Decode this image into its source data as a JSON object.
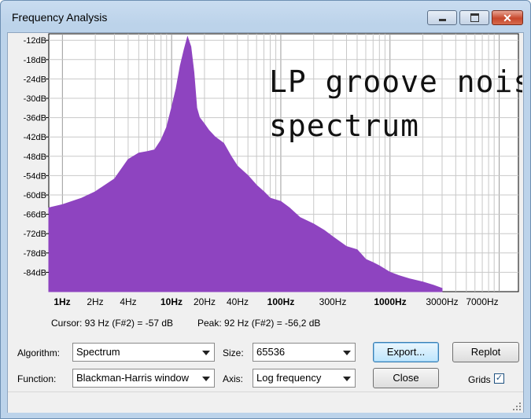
{
  "window": {
    "title": "Frequency Analysis"
  },
  "chart_data": {
    "type": "area",
    "annotation": "LP groove noise\nspectrum",
    "x_scale": "log",
    "xlim": [
      0.75,
      15000
    ],
    "ylim": [
      -90,
      -10
    ],
    "grid": true,
    "y_ticks": [
      "-12dB",
      "-18dB",
      "-24dB",
      "-30dB",
      "-36dB",
      "-42dB",
      "-48dB",
      "-54dB",
      "-60dB",
      "-66dB",
      "-72dB",
      "-78dB",
      "-84dB"
    ],
    "x_ticks": [
      {
        "label": "1Hz",
        "value": 1,
        "bold": true
      },
      {
        "label": "2Hz",
        "value": 2,
        "bold": false
      },
      {
        "label": "4Hz",
        "value": 4,
        "bold": false
      },
      {
        "label": "10Hz",
        "value": 10,
        "bold": true
      },
      {
        "label": "20Hz",
        "value": 20,
        "bold": false
      },
      {
        "label": "40Hz",
        "value": 40,
        "bold": false
      },
      {
        "label": "100Hz",
        "value": 100,
        "bold": true
      },
      {
        "label": "300Hz",
        "value": 300,
        "bold": false
      },
      {
        "label": "1000Hz",
        "value": 1000,
        "bold": true
      },
      {
        "label": "3000Hz",
        "value": 3000,
        "bold": false
      },
      {
        "label": "7000Hz",
        "value": 7000,
        "bold": false
      }
    ],
    "series": [
      {
        "color": "#8e44c0",
        "x": [
          0.75,
          1,
          1.5,
          2,
          3,
          4,
          5,
          6,
          7,
          8,
          9,
          10,
          11,
          12,
          13,
          14,
          15,
          16,
          17,
          18,
          20,
          22,
          25,
          30,
          35,
          40,
          50,
          60,
          70,
          80,
          100,
          120,
          150,
          200,
          250,
          300,
          400,
          500,
          600,
          700,
          800,
          1000,
          1200,
          1500,
          2000,
          2500,
          3000
        ],
        "y": [
          -64,
          -63,
          -61,
          -59,
          -55,
          -49,
          -47,
          -46.5,
          -46,
          -43,
          -39,
          -33,
          -27,
          -20,
          -15,
          -11,
          -14,
          -22,
          -33,
          -36,
          -38,
          -40,
          -42,
          -44,
          -48,
          -51,
          -54,
          -57,
          -59,
          -61,
          -62,
          -64,
          -67,
          -69,
          -71,
          -73,
          -76,
          -77,
          -80,
          -81,
          -82,
          -84,
          -85,
          -86,
          -87,
          -88,
          -89
        ]
      }
    ]
  },
  "cursor_text": "Cursor: 93 Hz (F#2) = -57 dB",
  "peak_text": "Peak: 92 Hz (F#2) = -56,2 dB",
  "controls": {
    "algorithm_label": "Algorithm:",
    "algorithm_value": "Spectrum",
    "size_label": "Size:",
    "size_value": "65536",
    "export_label": "Export...",
    "replot_label": "Replot",
    "function_label": "Function:",
    "function_value": "Blackman-Harris window",
    "axis_label": "Axis:",
    "axis_value": "Log frequency",
    "close_label": "Close",
    "grids_label": "Grids",
    "grids_checked": true
  }
}
